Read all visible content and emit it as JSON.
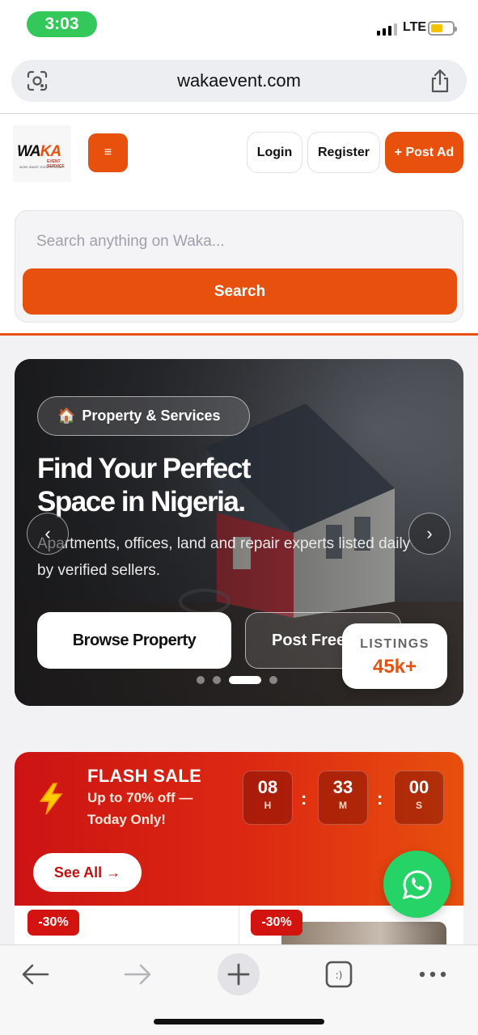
{
  "status_bar": {
    "time": "3:03",
    "network": "LTE"
  },
  "browser": {
    "url": "wakaevent.com"
  },
  "header": {
    "logo_text_a": "WA",
    "logo_text_b": "KA",
    "logo_sub": "EVENT SERVICE",
    "logo_tagline": "WORK SMART. EVENT STRONG",
    "menu_icon": "≡",
    "login_label": "Login",
    "register_label": "Register",
    "post_ad_label": "+ Post Ad"
  },
  "search": {
    "placeholder": "Search anything on Waka...",
    "value": "",
    "button_label": "Search"
  },
  "hero": {
    "badge_icon": "🏠",
    "badge_label": "Property & Services",
    "title_line1": "Find Your Perfect",
    "title_line2": "Space in Nigeria.",
    "description": "Apartments, offices, land and repair experts listed daily by verified sellers.",
    "browse_label": "Browse Property",
    "post_free_label": "Post Free",
    "prev_icon": "‹",
    "next_icon": "›",
    "slides": 4,
    "active_slide": 3,
    "listings_label": "LISTINGS",
    "listings_value": "45k+"
  },
  "flash_sale": {
    "title": "FLASH SALE",
    "subtitle": "Up to 70% off — Today Only!",
    "hours": "08",
    "minutes": "33",
    "seconds": "00",
    "hours_unit": "H",
    "minutes_unit": "M",
    "seconds_unit": "S",
    "separator": ":",
    "see_all_label": "See All →",
    "discounts": [
      "-30%",
      "-30%"
    ]
  },
  "colors": {
    "brand": "#e8500e",
    "flash_red": "#cc1313",
    "whatsapp": "#25d366",
    "status_green": "#34c759"
  },
  "icons": [
    "lens-icon",
    "share-icon",
    "menu-icon",
    "bolt-icon",
    "whatsapp-icon",
    "back-icon",
    "forward-icon",
    "plus-icon",
    "tabs-icon",
    "more-icon"
  ]
}
